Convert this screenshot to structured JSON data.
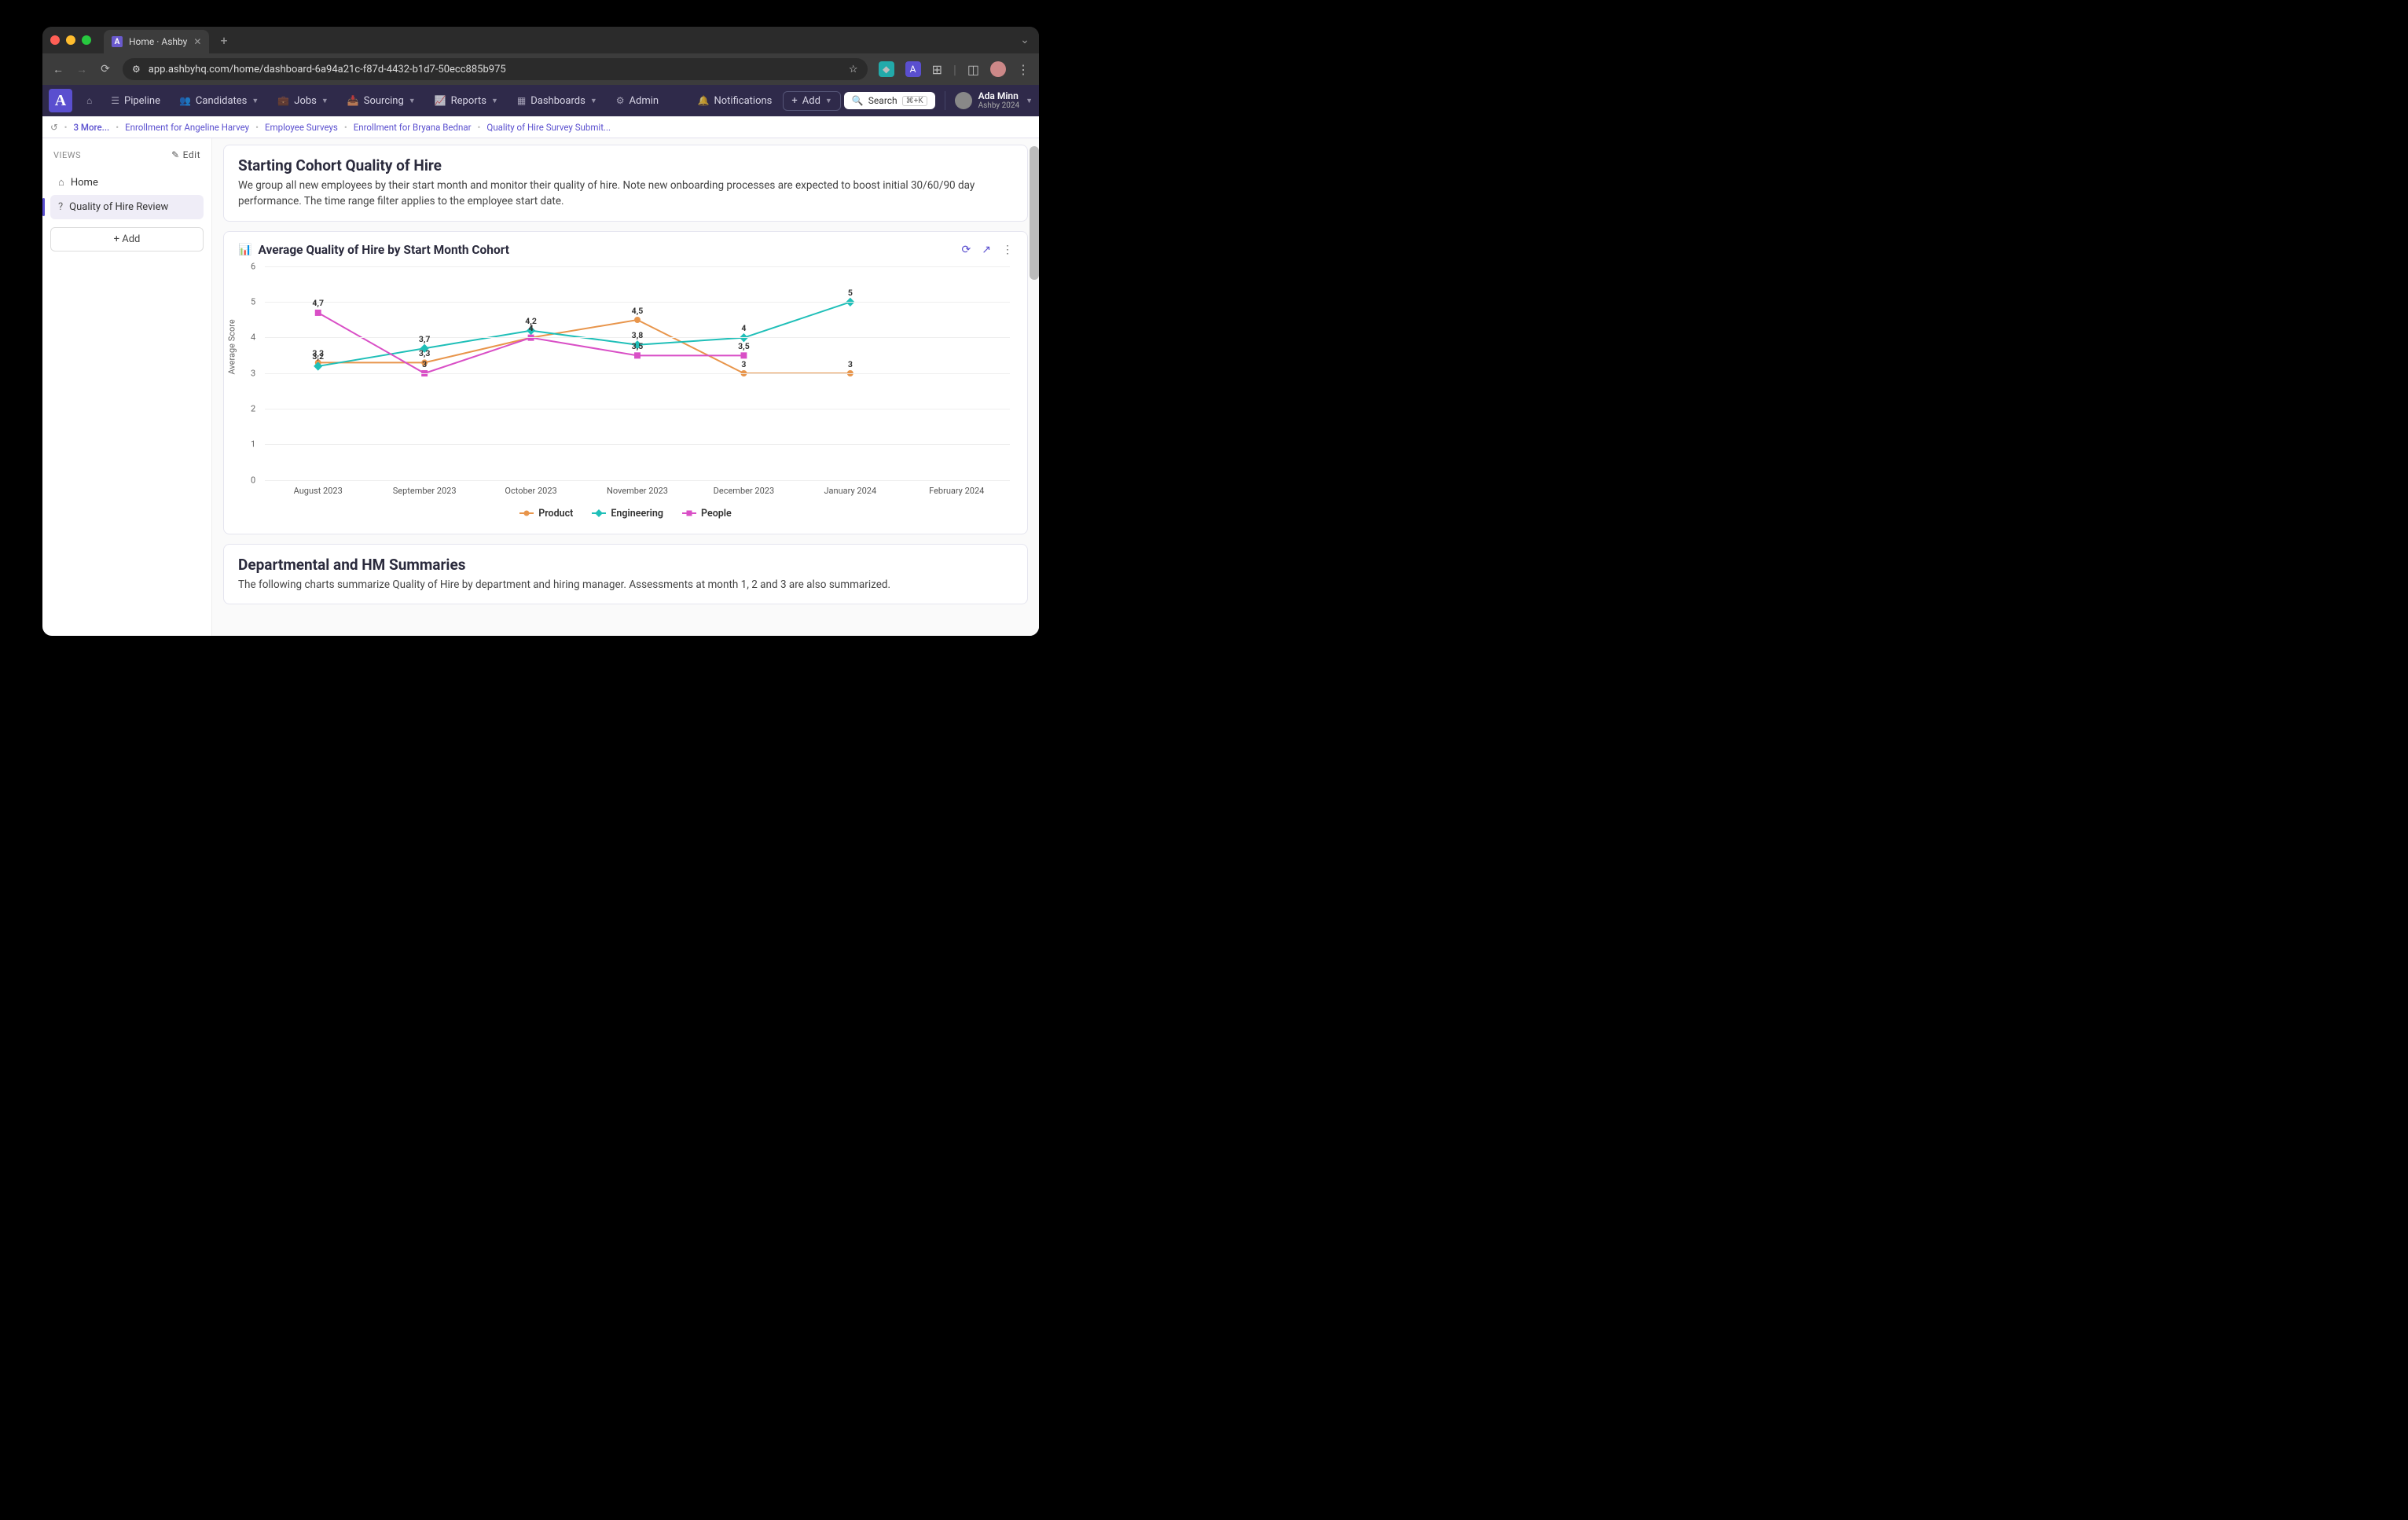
{
  "browser": {
    "tab_title": "Home · Ashby",
    "url": "app.ashbyhq.com/home/dashboard-6a94a21c-f87d-4432-b1d7-50ecc885b975"
  },
  "topbar": {
    "items": [
      {
        "label": "Pipeline",
        "has_dropdown": false
      },
      {
        "label": "Candidates",
        "has_dropdown": true
      },
      {
        "label": "Jobs",
        "has_dropdown": true
      },
      {
        "label": "Sourcing",
        "has_dropdown": true
      },
      {
        "label": "Reports",
        "has_dropdown": true
      },
      {
        "label": "Dashboards",
        "has_dropdown": true
      },
      {
        "label": "Admin",
        "has_dropdown": false
      }
    ],
    "notifications_label": "Notifications",
    "add_label": "Add",
    "search_label": "Search",
    "search_shortcut": "⌘+K",
    "user_name": "Ada Minn",
    "user_org": "Ashby 2024"
  },
  "breadcrumbs": {
    "more": "3 More...",
    "items": [
      "Enrollment for Angeline Harvey",
      "Employee Surveys",
      "Enrollment for Bryana Bednar",
      "Quality of Hire Survey Submit..."
    ]
  },
  "sidebar": {
    "header": "VIEWS",
    "edit_label": "Edit",
    "items": [
      {
        "label": "Home",
        "icon": "home",
        "active": false
      },
      {
        "label": "Quality of Hire Review",
        "icon": "help",
        "active": true
      }
    ],
    "add_label": "Add"
  },
  "card1": {
    "title": "Starting Cohort Quality of Hire",
    "desc": "We group all new employees by their start month and monitor their quality of hire. Note new onboarding processes are expected to boost initial 30/60/90 day performance. The time range filter applies to the employee start date."
  },
  "chart_card": {
    "title": "Average Quality of Hire by Start Month Cohort"
  },
  "chart_data": {
    "type": "line",
    "ylabel": "Average Score",
    "xlabel": "",
    "ylim": [
      0,
      6
    ],
    "categories": [
      "August 2023",
      "September 2023",
      "October 2023",
      "November 2023",
      "December 2023",
      "January 2024",
      "February 2024"
    ],
    "y_ticks": [
      0,
      1,
      2,
      3,
      4,
      5,
      6
    ],
    "series": [
      {
        "name": "Product",
        "color": "#e8954b",
        "marker": "circle",
        "values": [
          3.3,
          3.3,
          4,
          4.5,
          3,
          3,
          null
        ]
      },
      {
        "name": "Engineering",
        "color": "#1fbfb8",
        "marker": "diamond",
        "values": [
          3.2,
          3.7,
          4.2,
          3.8,
          4,
          5,
          null
        ]
      },
      {
        "name": "People",
        "color": "#d94fc6",
        "marker": "square",
        "values": [
          4.7,
          3,
          4,
          3.5,
          3.5,
          null,
          null
        ]
      }
    ]
  },
  "card2": {
    "title": "Departmental and HM Summaries",
    "desc": "The following charts summarize Quality of Hire by department and hiring manager. Assessments at month 1, 2 and 3 are also summarized."
  }
}
